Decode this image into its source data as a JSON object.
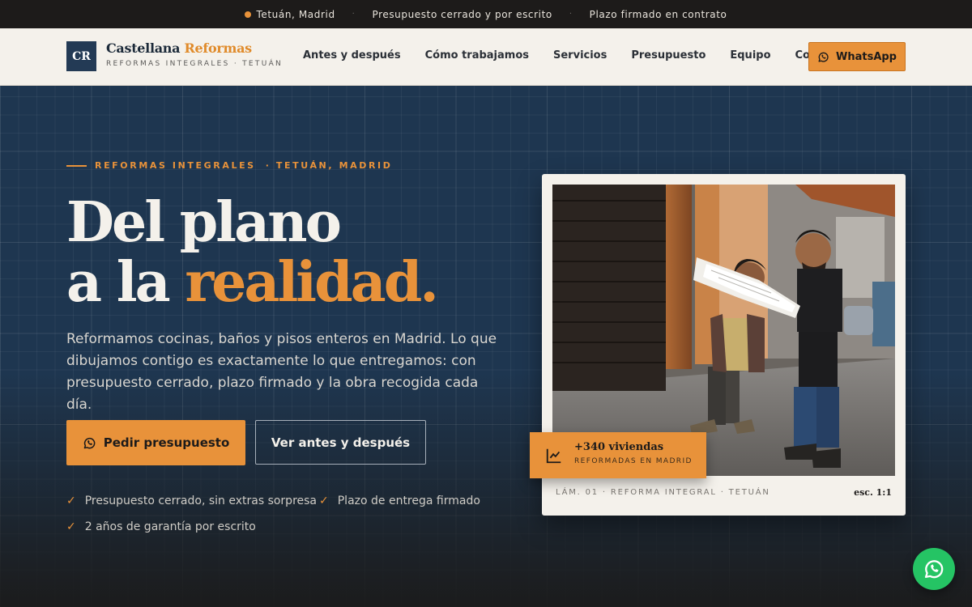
{
  "topbar": {
    "location": "Tetuán, Madrid",
    "point_1": "Presupuesto cerrado y por escrito",
    "point_2": "Plazo firmado en contrato",
    "separator": "·"
  },
  "header": {
    "logo_initials": "CR",
    "brand_name": "Castellana",
    "brand_accent": "Reformas",
    "brand_tagline": "REFORMAS INTEGRALES · TETUÁN",
    "nav": [
      "Antes y después",
      "Cómo trabajamos",
      "Servicios",
      "Presupuesto",
      "Equipo",
      "Contacto"
    ],
    "whatsapp_label": "WhatsApp"
  },
  "hero": {
    "eyebrow_1": "REFORMAS INTEGRALES",
    "eyebrow_2": "· TETUÁN, MADRID",
    "headline_line1": "Del plano",
    "headline_line2_plain": "a la ",
    "headline_line2_accent": "realidad.",
    "lede": "Reformamos cocinas, baños y pisos enteros en Madrid. Lo que dibujamos contigo es exactamente lo que entregamos: con presupuesto cerrado, plazo firmado y la obra recogida cada día.",
    "cta_primary": "Pedir presupuesto",
    "cta_secondary": "Ver antes y después",
    "features": [
      "Presupuesto cerrado, sin extras sorpresa",
      "Plazo de entrega firmado",
      "2 años de garantía por escrito"
    ]
  },
  "card": {
    "caption": "LÁM. 01 · REFORMA INTEGRAL · TETUÁN",
    "scale": "esc. 1:1",
    "stat_number": "+340 viviendas",
    "stat_label": "REFORMADAS EN MADRID"
  },
  "colors": {
    "accent": "#e8923a",
    "navy": "#1e3650",
    "cream": "#f4f1eb",
    "whatsapp_green": "#25c464"
  },
  "icons": {
    "whatsapp": "whatsapp-icon",
    "check": "check-icon",
    "chart": "trend-chart-icon"
  }
}
